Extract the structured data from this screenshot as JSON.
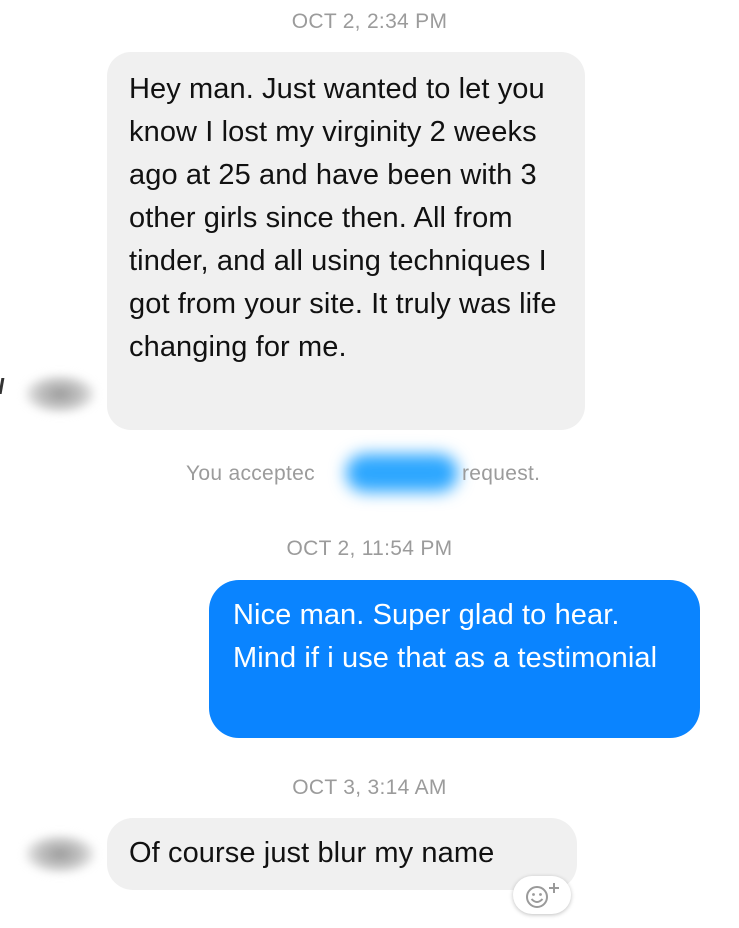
{
  "conversation": {
    "messages": [
      {
        "timestamp": "OCT 2, 2:34 PM",
        "direction": "incoming",
        "text": "Hey man. Just wanted to let you know I lost my virginity 2 weeks ago at 25 and have been with 3 other girls since then. All from tinder, and all using techniques I got from your site. It truly was life changing for me."
      },
      {
        "system_prefix": "You acceptec",
        "system_suffix": "request."
      },
      {
        "timestamp": "OCT 2, 11:54 PM",
        "direction": "outgoing",
        "text": "Nice man. Super glad to hear. Mind if i use that as a testimonial"
      },
      {
        "timestamp": "OCT 3, 3:14 AM",
        "direction": "incoming",
        "text": "Of course just blur my name"
      }
    ]
  },
  "colors": {
    "incoming_bubble": "#f0f0f0",
    "outgoing_bubble": "#0a84ff",
    "timestamp_text": "#9b9b9b",
    "redaction": "#2da7ff"
  },
  "icons": [
    "add-reaction-icon"
  ]
}
